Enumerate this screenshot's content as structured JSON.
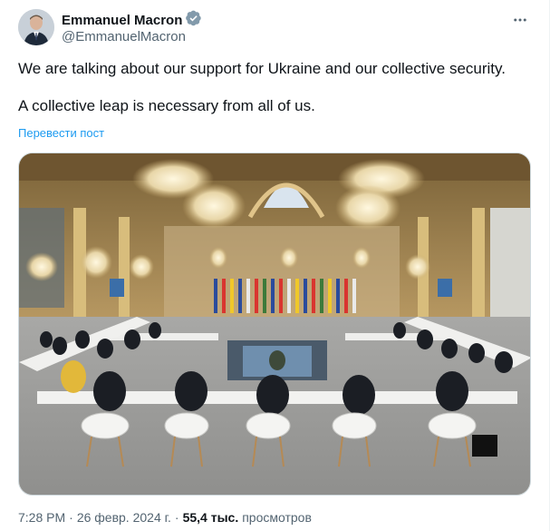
{
  "author": {
    "name": "Emmanuel Macron",
    "handle": "@EmmanuelMacron",
    "verified_color": "#829aab"
  },
  "post": {
    "text_line1": "We are talking about our support for Ukraine and our collective security.",
    "text_line2": "A collective leap is necessary from all of us.",
    "translate_label": "Перевести пост"
  },
  "meta": {
    "time": "7:28 PM",
    "sep1": "·",
    "date": "26 февр. 2024 г.",
    "sep2": "·",
    "views_count": "55,4 тыс.",
    "views_label": "просмотров"
  },
  "colors": {
    "link": "#1d9bf0",
    "secondary_text": "#536471",
    "primary_text": "#0f1419"
  },
  "icons": {
    "verified": "verified-badge-icon",
    "more": "more-dots-icon"
  }
}
